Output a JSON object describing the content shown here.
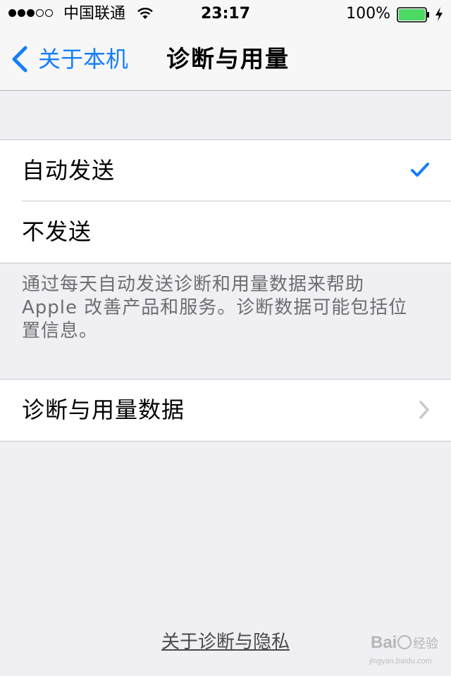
{
  "status_bar": {
    "carrier": "中国联通",
    "signal_bars_filled": 3,
    "signal_bars_total": 5,
    "time": "23:17",
    "battery_percent": "100%",
    "battery_level": 1.0,
    "battery_color": "#4cd964",
    "icons": [
      "signal-dots-icon",
      "wifi-icon",
      "battery-icon",
      "charging-bolt-icon"
    ]
  },
  "nav": {
    "back_label": "关于本机",
    "title": "诊断与用量",
    "accent_color": "#157efb"
  },
  "send_options": [
    {
      "label": "自动发送",
      "selected": true
    },
    {
      "label": "不发送",
      "selected": false
    }
  ],
  "send_footer": "通过每天自动发送诊断和用量数据来帮助 Apple 改善产品和服务。诊断数据可能包括位置信息。",
  "data_row": {
    "label": "诊断与用量数据"
  },
  "bottom_link": "关于诊断与隐私",
  "watermark": {
    "logo": "Bai百经验",
    "url": "jingyan.baidu.com"
  }
}
